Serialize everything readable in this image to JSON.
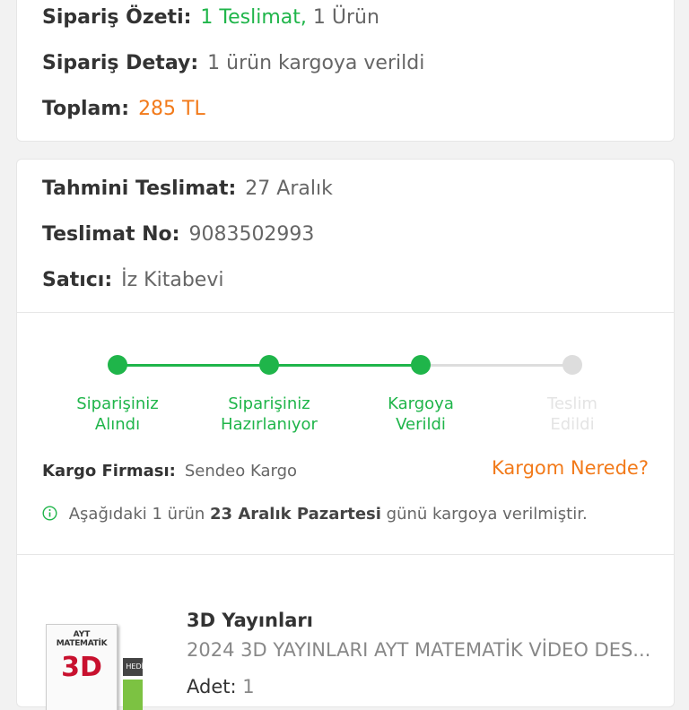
{
  "summary": {
    "order_summary_label": "Sipariş Özeti:",
    "order_summary_delivery": "1 Teslimat,",
    "order_summary_items": "1 Ürün",
    "order_detail_label": "Sipariş Detay:",
    "order_detail_value": "1 ürün kargoya verildi",
    "total_label": "Toplam:",
    "total_value": "285 TL"
  },
  "delivery": {
    "estimated_label": "Tahmini Teslimat:",
    "estimated_value": "27 Aralık",
    "delivery_no_label": "Teslimat No:",
    "delivery_no_value": "9083502993",
    "seller_label": "Satıcı:",
    "seller_value": "İz Kitabevi"
  },
  "tracker": {
    "steps": [
      {
        "line1": "Siparişiniz",
        "line2": "Alındı",
        "done": true
      },
      {
        "line1": "Siparişiniz",
        "line2": "Hazırlanıyor",
        "done": true
      },
      {
        "line1": "Kargoya",
        "line2": "Verildi",
        "done": true
      },
      {
        "line1": "Teslim",
        "line2": "Edildi",
        "done": false
      }
    ]
  },
  "cargo": {
    "company_label": "Kargo Firması:",
    "company_value": "Sendeo Kargo",
    "where_link": "Kargom Nerede?",
    "info_pre": "Aşağıdaki 1 ürün",
    "info_bold": "23 Aralık Pazartesi",
    "info_post": "günü kargoya verilmiştir."
  },
  "product": {
    "brand": "3D Yayınları",
    "title": "2024 3D YAYINLARI AYT MATEMATİK VİDEO DES...",
    "qty_label": "Adet:",
    "qty_value": "1",
    "image_text_top": "AYT",
    "image_text_mid": "MATEMATİK",
    "image_text_big": "3D",
    "image_badge": "HEDİYE..."
  },
  "colors": {
    "green": "#1fb54a",
    "orange": "#f27a1a",
    "gray_step": "#dddddd"
  }
}
